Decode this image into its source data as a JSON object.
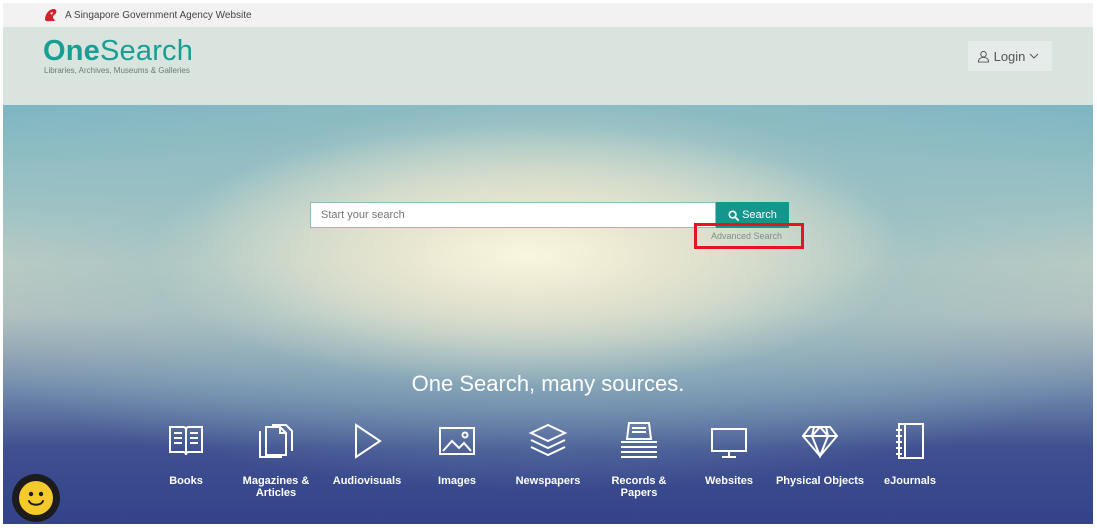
{
  "gov_bar": {
    "text": "A Singapore Government Agency Website"
  },
  "header": {
    "logo_bold": "One",
    "logo_light": "Search",
    "logo_tagline": "Libraries, Archives, Museums & Galleries",
    "login_label": "Login"
  },
  "search": {
    "placeholder": "Start your search",
    "button_label": "Search",
    "advanced_label": "Advanced Search"
  },
  "hero_tagline": "One Search, many sources.",
  "sources": [
    {
      "line1": "Books",
      "line2": "",
      "icon": "book-icon"
    },
    {
      "line1": "Magazines &",
      "line2": "Articles",
      "icon": "magazine-icon"
    },
    {
      "line1": "Audiovisuals",
      "line2": "",
      "icon": "play-icon"
    },
    {
      "line1": "Images",
      "line2": "",
      "icon": "image-icon"
    },
    {
      "line1": "Newspapers",
      "line2": "",
      "icon": "layers-icon"
    },
    {
      "line1": "Records &",
      "line2": "Papers",
      "icon": "papers-icon"
    },
    {
      "line1": "Websites",
      "line2": "",
      "icon": "monitor-icon"
    },
    {
      "line1": "Physical Objects",
      "line2": "",
      "icon": "diamond-icon"
    },
    {
      "line1": "eJournals",
      "line2": "",
      "icon": "notebook-icon"
    }
  ],
  "colors": {
    "brand_teal": "#1a9e94",
    "search_button": "#15968d",
    "highlight_red": "#e4161b",
    "header_bg": "#d9e4df"
  }
}
